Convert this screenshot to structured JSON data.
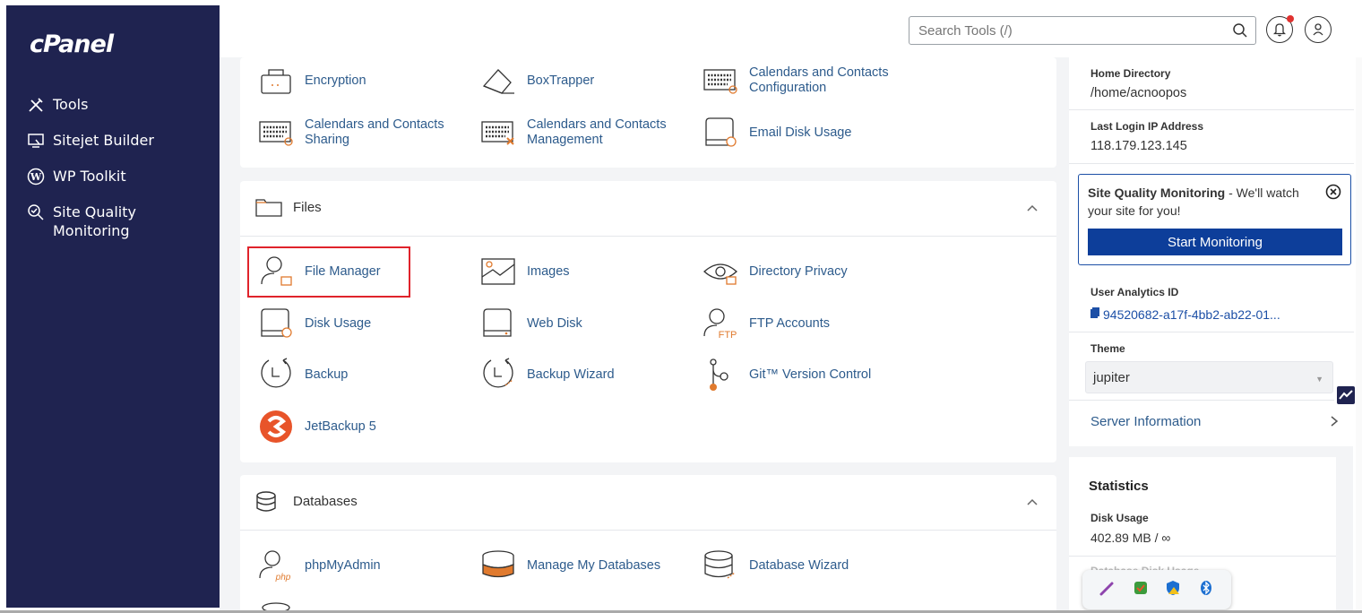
{
  "brand": {
    "logo": "cPanel"
  },
  "sidebar": {
    "items": [
      {
        "label": "Tools",
        "icon": "tools-icon"
      },
      {
        "label": "Sitejet Builder",
        "icon": "sitejet-icon"
      },
      {
        "label": "WP Toolkit",
        "icon": "wordpress-icon"
      },
      {
        "label": "Site Quality Monitoring",
        "icon": "magnifier-check-icon"
      }
    ]
  },
  "topbar": {
    "search_placeholder": "Search Tools (/)"
  },
  "security_tools": [
    {
      "label": "Encryption"
    },
    {
      "label": "BoxTrapper"
    },
    {
      "label": "Calendars and Contacts\nConfiguration"
    },
    {
      "label": "Calendars and Contacts\nSharing"
    },
    {
      "label": "Calendars and Contacts\nManagement"
    },
    {
      "label": "Email Disk Usage"
    }
  ],
  "files": {
    "title": "Files",
    "tools": [
      {
        "label": "File Manager"
      },
      {
        "label": "Images"
      },
      {
        "label": "Directory Privacy"
      },
      {
        "label": "Disk Usage"
      },
      {
        "label": "Web Disk"
      },
      {
        "label": "FTP Accounts"
      },
      {
        "label": "Backup"
      },
      {
        "label": "Backup Wizard"
      },
      {
        "label": "Git™ Version Control"
      },
      {
        "label": "JetBackup 5"
      }
    ]
  },
  "databases": {
    "title": "Databases",
    "tools": [
      {
        "label": "phpMyAdmin"
      },
      {
        "label": "Manage My Databases"
      },
      {
        "label": "Database Wizard"
      }
    ]
  },
  "general_info": {
    "home_directory_label": "Home Directory",
    "home_directory": "/home/acnoopos",
    "last_login_label": "Last Login IP Address",
    "last_login_ip": "118.179.123.145",
    "sqm_title": "Site Quality Monitoring",
    "sqm_text": " - We'll watch your site for you!",
    "sqm_button": "Start Monitoring",
    "analytics_label": "User Analytics ID",
    "analytics_id": "94520682-a17f-4bb2-ab22-01...",
    "theme_label": "Theme",
    "theme_value": "jupiter",
    "server_info": "Server Information"
  },
  "statistics": {
    "title": "Statistics",
    "disk_usage_label": "Disk Usage",
    "disk_usage_value": "402.89 MB / ∞",
    "db_disk_usage_label": "Database Disk Usage"
  },
  "colors": {
    "sidebar_bg": "#1f2350",
    "link": "#2d5b8c",
    "accent": "#0d3e9a",
    "highlight": "#e0232b"
  }
}
